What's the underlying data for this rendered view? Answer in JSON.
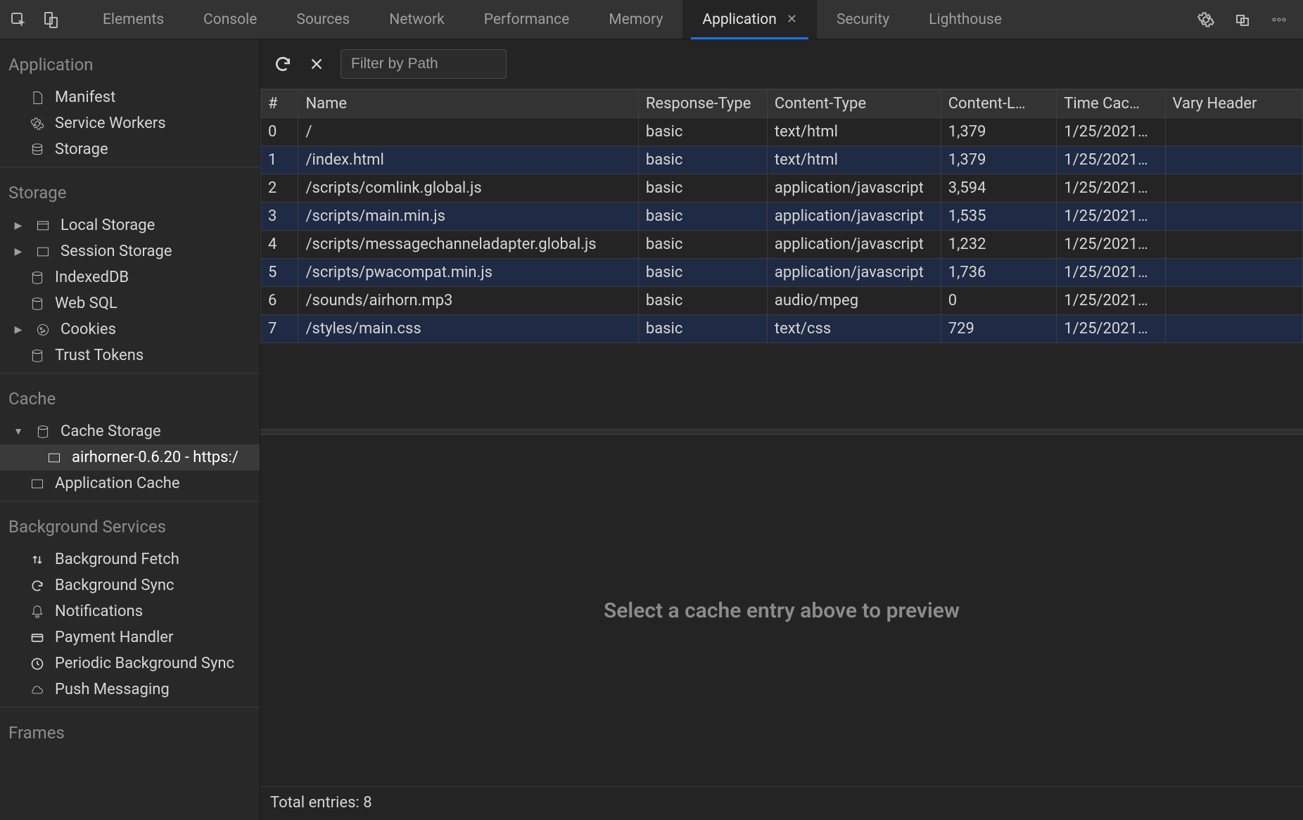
{
  "tabs": {
    "items": [
      {
        "label": "Elements"
      },
      {
        "label": "Console"
      },
      {
        "label": "Sources"
      },
      {
        "label": "Network"
      },
      {
        "label": "Performance"
      },
      {
        "label": "Memory"
      },
      {
        "label": "Application",
        "active": true
      },
      {
        "label": "Security"
      },
      {
        "label": "Lighthouse"
      }
    ]
  },
  "sidebar": {
    "sections": [
      {
        "title": "Application",
        "items": [
          {
            "label": "Manifest",
            "icon": "file"
          },
          {
            "label": "Service Workers",
            "icon": "gear"
          },
          {
            "label": "Storage",
            "icon": "db"
          }
        ]
      },
      {
        "title": "Storage",
        "items": [
          {
            "label": "Local Storage",
            "icon": "grid",
            "expand": "right"
          },
          {
            "label": "Session Storage",
            "icon": "grid",
            "expand": "right"
          },
          {
            "label": "IndexedDB",
            "icon": "db"
          },
          {
            "label": "Web SQL",
            "icon": "db"
          },
          {
            "label": "Cookies",
            "icon": "cookie",
            "expand": "right"
          },
          {
            "label": "Trust Tokens",
            "icon": "db"
          }
        ]
      },
      {
        "title": "Cache",
        "items": [
          {
            "label": "Cache Storage",
            "icon": "db",
            "expand": "down"
          },
          {
            "label": "airhorner-0.6.20 - https:/",
            "icon": "grid",
            "nested": true,
            "selected": true
          },
          {
            "label": "Application Cache",
            "icon": "grid"
          }
        ]
      },
      {
        "title": "Background Services",
        "items": [
          {
            "label": "Background Fetch",
            "icon": "updown"
          },
          {
            "label": "Background Sync",
            "icon": "sync"
          },
          {
            "label": "Notifications",
            "icon": "bell"
          },
          {
            "label": "Payment Handler",
            "icon": "card"
          },
          {
            "label": "Periodic Background Sync",
            "icon": "clock"
          },
          {
            "label": "Push Messaging",
            "icon": "cloud"
          }
        ]
      },
      {
        "title": "Frames",
        "items": []
      }
    ]
  },
  "toolbar": {
    "filter_placeholder": "Filter by Path"
  },
  "table": {
    "columns": [
      "#",
      "Name",
      "Response-Type",
      "Content-Type",
      "Content-L…",
      "Time Cac…",
      "Vary Header"
    ],
    "rows": [
      {
        "n": "0",
        "name": "/",
        "resp": "basic",
        "ctype": "text/html",
        "clen": "1,379",
        "time": "1/25/2021…",
        "vary": ""
      },
      {
        "n": "1",
        "name": "/index.html",
        "resp": "basic",
        "ctype": "text/html",
        "clen": "1,379",
        "time": "1/25/2021…",
        "vary": ""
      },
      {
        "n": "2",
        "name": "/scripts/comlink.global.js",
        "resp": "basic",
        "ctype": "application/javascript",
        "clen": "3,594",
        "time": "1/25/2021…",
        "vary": ""
      },
      {
        "n": "3",
        "name": "/scripts/main.min.js",
        "resp": "basic",
        "ctype": "application/javascript",
        "clen": "1,535",
        "time": "1/25/2021…",
        "vary": ""
      },
      {
        "n": "4",
        "name": "/scripts/messagechanneladapter.global.js",
        "resp": "basic",
        "ctype": "application/javascript",
        "clen": "1,232",
        "time": "1/25/2021…",
        "vary": ""
      },
      {
        "n": "5",
        "name": "/scripts/pwacompat.min.js",
        "resp": "basic",
        "ctype": "application/javascript",
        "clen": "1,736",
        "time": "1/25/2021…",
        "vary": ""
      },
      {
        "n": "6",
        "name": "/sounds/airhorn.mp3",
        "resp": "basic",
        "ctype": "audio/mpeg",
        "clen": "0",
        "time": "1/25/2021…",
        "vary": ""
      },
      {
        "n": "7",
        "name": "/styles/main.css",
        "resp": "basic",
        "ctype": "text/css",
        "clen": "729",
        "time": "1/25/2021…",
        "vary": ""
      }
    ]
  },
  "preview": {
    "empty_msg": "Select a cache entry above to preview"
  },
  "status": {
    "total_label": "Total entries: 8"
  }
}
